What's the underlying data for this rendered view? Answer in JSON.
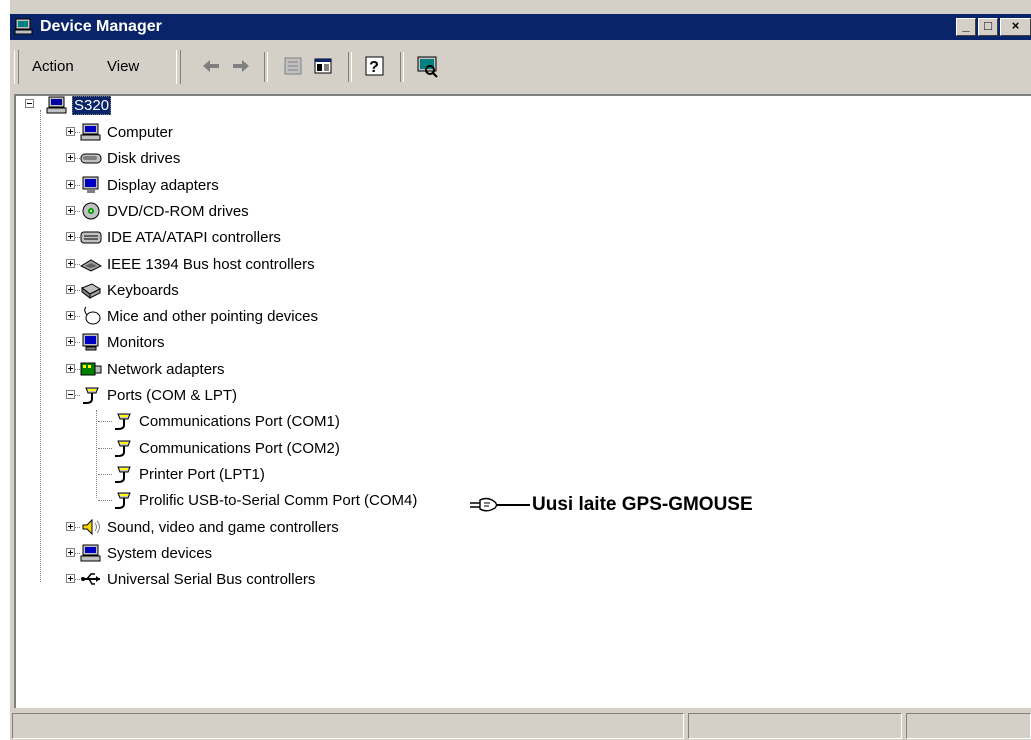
{
  "window": {
    "title": "Device Manager",
    "caption_buttons": {
      "minimize": "_",
      "maximize": "□",
      "close": "×"
    }
  },
  "menu": {
    "action_label": "Action",
    "view_label": "View"
  },
  "toolbar_icons": [
    "back-arrow-icon",
    "forward-arrow-icon",
    "properties-icon",
    "show-hide-tree-icon",
    "help-icon",
    "scan-hardware-icon"
  ],
  "tree": {
    "root": {
      "label": "S320",
      "selected": true
    },
    "categories": [
      {
        "label": "Computer",
        "icon": "computer-icon",
        "expanded": false
      },
      {
        "label": "Disk drives",
        "icon": "disk-drive-icon",
        "expanded": false
      },
      {
        "label": "Display adapters",
        "icon": "display-adapter-icon",
        "expanded": false
      },
      {
        "label": "DVD/CD-ROM drives",
        "icon": "cdrom-icon",
        "expanded": false
      },
      {
        "label": "IDE ATA/ATAPI controllers",
        "icon": "ide-controller-icon",
        "expanded": false
      },
      {
        "label": "IEEE 1394 Bus host controllers",
        "icon": "ieee1394-icon",
        "expanded": false
      },
      {
        "label": "Keyboards",
        "icon": "keyboard-icon",
        "expanded": false
      },
      {
        "label": "Mice and other pointing devices",
        "icon": "mouse-icon",
        "expanded": false
      },
      {
        "label": "Monitors",
        "icon": "monitor-icon",
        "expanded": false
      },
      {
        "label": "Network adapters",
        "icon": "network-adapter-icon",
        "expanded": false
      },
      {
        "label": "Ports (COM & LPT)",
        "icon": "port-icon",
        "expanded": true
      },
      {
        "label": "Sound, video and game controllers",
        "icon": "sound-icon",
        "expanded": false
      },
      {
        "label": "System devices",
        "icon": "system-devices-icon",
        "expanded": false
      },
      {
        "label": "Universal Serial Bus controllers",
        "icon": "usb-icon",
        "expanded": false
      }
    ],
    "port_children": [
      "Communications Port (COM1)",
      "Communications Port (COM2)",
      "Printer Port (LPT1)",
      "Prolific USB-to-Serial Comm Port (COM4)"
    ]
  },
  "annotation": {
    "text": "Uusi laite GPS-GMOUSE",
    "icon": "pointing-hand-icon"
  },
  "colors": {
    "title_bar": "#0a246a",
    "chrome": "#d4d0c8",
    "selection": "#0a246a"
  }
}
